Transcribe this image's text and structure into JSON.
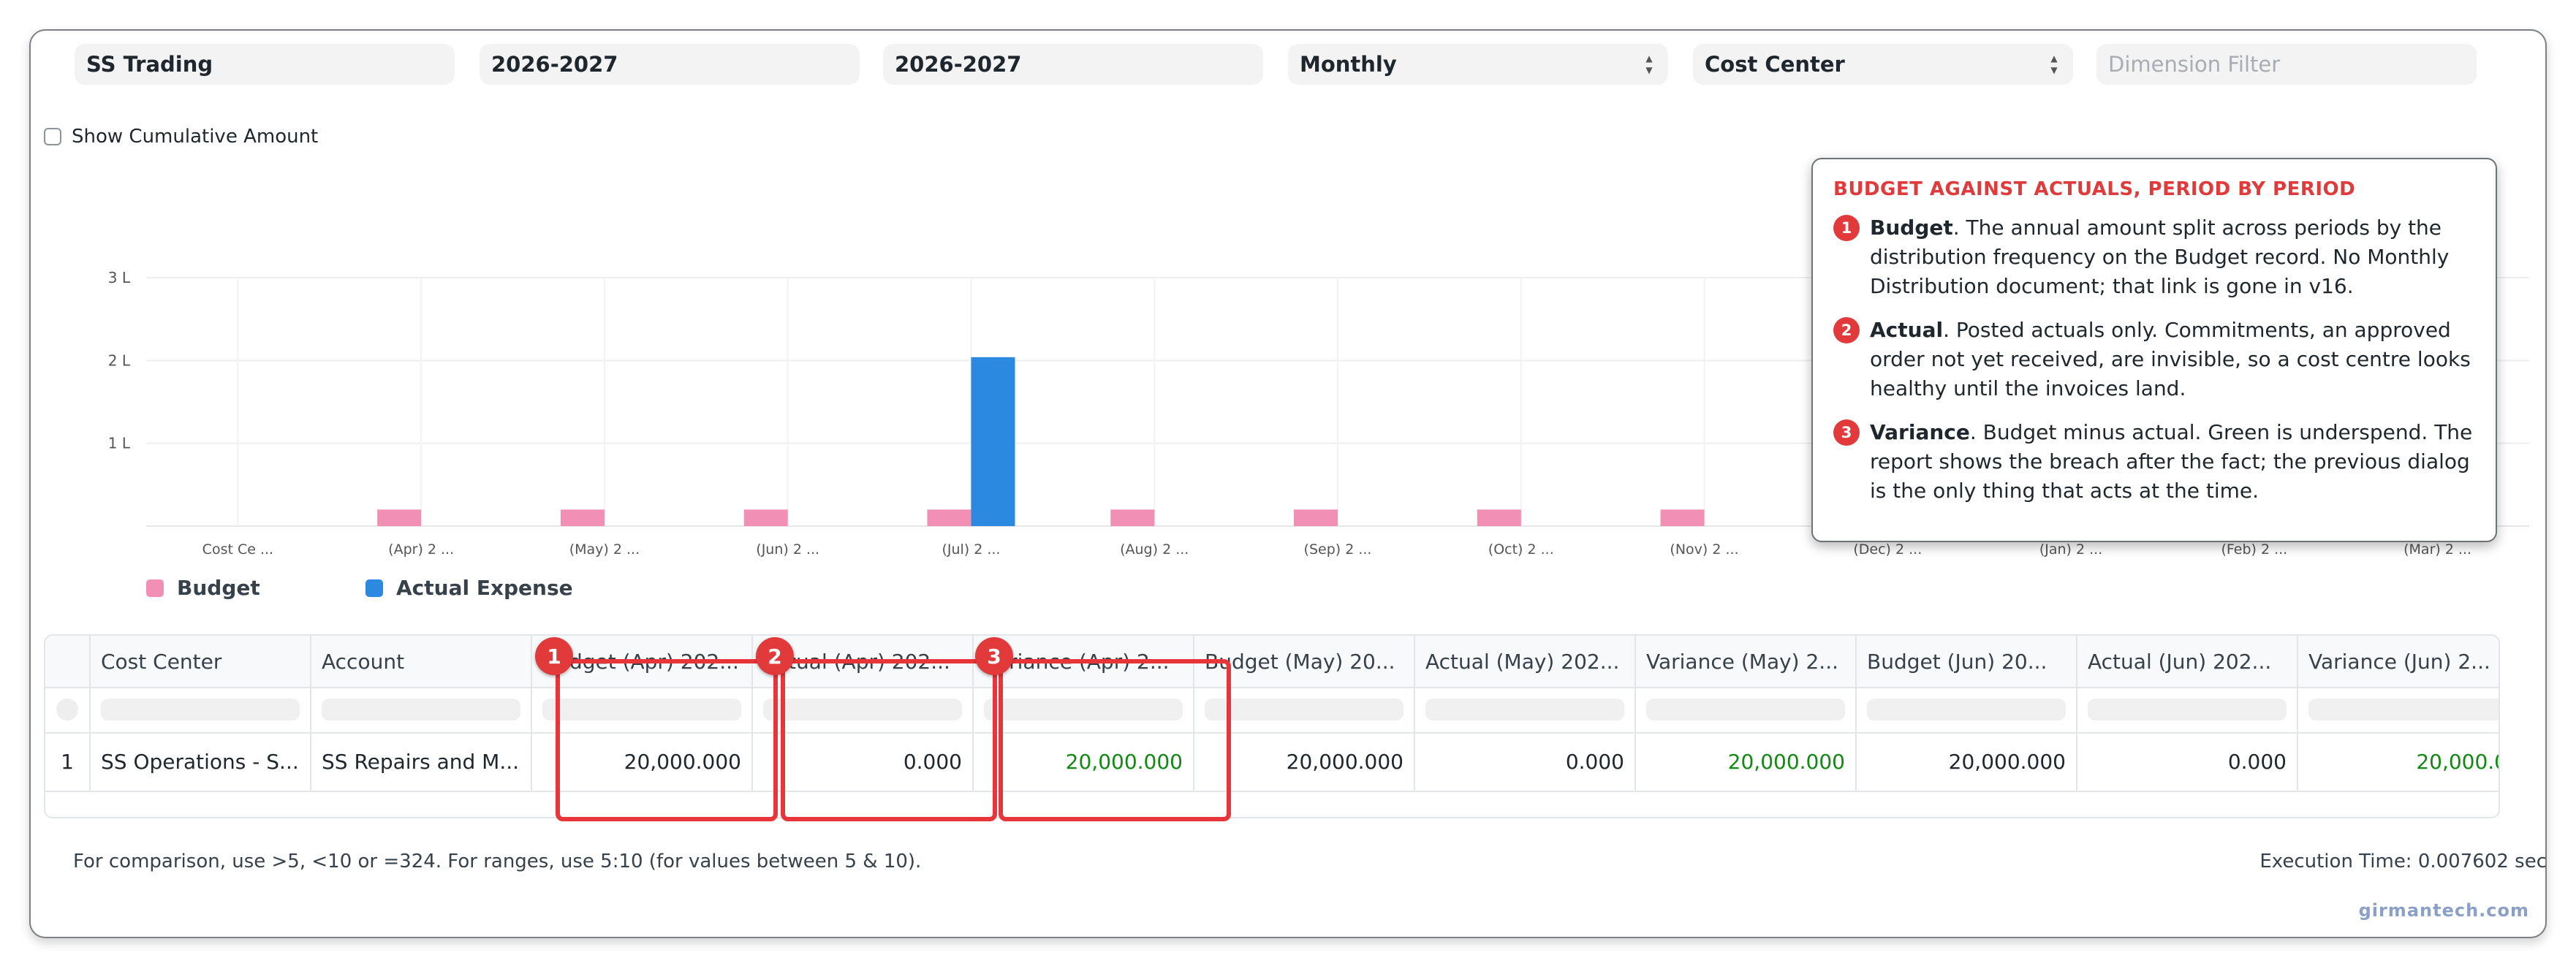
{
  "filters": {
    "company": "SS Trading",
    "from_fiscal_year": "2026-2027",
    "to_fiscal_year": "2026-2027",
    "period": "Monthly",
    "budget_against": "Cost Center",
    "dimension_placeholder": "Dimension Filter"
  },
  "show_cumulative_label": "Show Cumulative Amount",
  "chart_data": {
    "type": "bar",
    "categories": [
      "Cost Ce ...",
      "(Apr) 2 ...",
      "(May) 2 ...",
      "(Jun) 2 ...",
      "(Jul) 2 ...",
      "(Aug) 2 ...",
      "(Sep) 2 ...",
      "(Oct) 2 ...",
      "(Nov) 2 ...",
      "(Dec) 2 ...",
      "(Jan) 2 ...",
      "(Feb) 2 ...",
      "(Mar) 2 ..."
    ],
    "y_ticks": [
      "1 L",
      "2 L",
      "3 L"
    ],
    "ylim": [
      0,
      300000
    ],
    "series": [
      {
        "name": "Budget",
        "color": "#f28fb5",
        "values": [
          0,
          20000,
          20000,
          20000,
          20000,
          20000,
          20000,
          20000,
          20000,
          20000,
          20000,
          20000,
          20000
        ]
      },
      {
        "name": "Actual Expense",
        "color": "#2b8ae0",
        "values": [
          0,
          0,
          0,
          0,
          204000,
          0,
          0,
          0,
          0,
          0,
          0,
          0,
          0
        ]
      }
    ]
  },
  "legend": {
    "budget": "Budget",
    "actual": "Actual Expense"
  },
  "table": {
    "row_number": "1",
    "headers": [
      "Cost Center",
      "Account",
      "Budget (Apr) 202...",
      "Actual (Apr) 202...",
      "Variance (Apr) 2...",
      "Budget (May) 20...",
      "Actual (May) 202...",
      "Variance (May) 2...",
      "Budget (Jun) 20...",
      "Actual (Jun) 202...",
      "Variance (Jun) 2..."
    ],
    "row": [
      "SS Operations - S...",
      "SS Repairs and M...",
      "20,000.000",
      "0.000",
      "20,000.000",
      "20,000.000",
      "0.000",
      "20,000.000",
      "20,000.000",
      "0.000",
      "20,000.0"
    ]
  },
  "badges": [
    "1",
    "2",
    "3"
  ],
  "callout": {
    "title": "BUDGET AGAINST ACTUALS, PERIOD BY PERIOD",
    "items": [
      {
        "num": "1",
        "term": "Budget",
        "text": ". The annual amount split across periods by the distribution frequency on the Budget record. No Monthly Distribution document; that link is gone in v16."
      },
      {
        "num": "2",
        "term": "Actual",
        "text": ". Posted actuals only. Commitments, an approved order not yet received, are invisible, so a cost centre looks healthy until the invoices land."
      },
      {
        "num": "3",
        "term": "Variance",
        "text": ". Budget minus actual. Green is underspend. The report shows the breach after the fact; the previous dialog is the only thing that acts at the time."
      }
    ]
  },
  "footer_note": "For comparison, use >5, <10 or =324. For ranges, use 5:10 (for values between 5 & 10).",
  "execution_time": "Execution Time: 0.007602 sec",
  "brand": "girmantech.com"
}
